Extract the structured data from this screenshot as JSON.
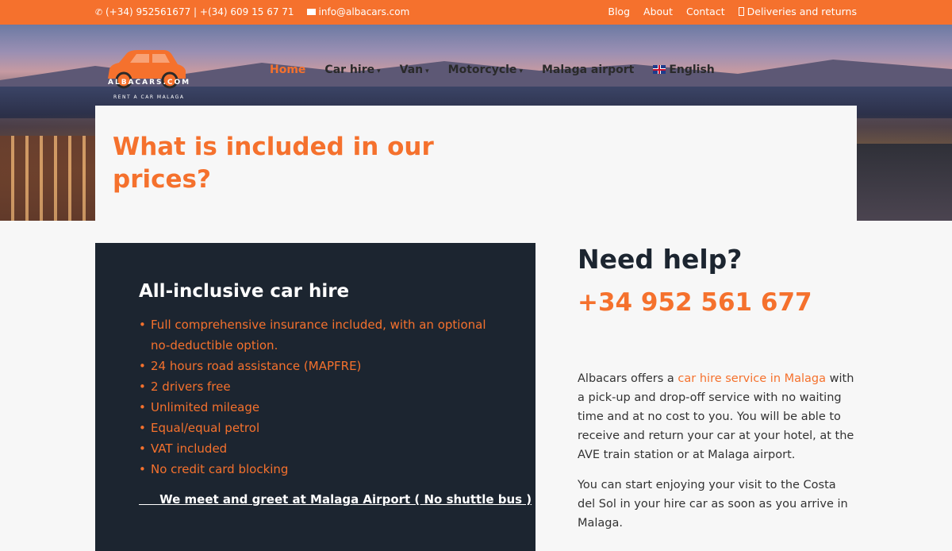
{
  "topbar": {
    "phones": "(+34) 952561677 | +(34) 609 15 67 71",
    "email": "info@albacars.com",
    "links": [
      "Blog",
      "About",
      "Contact",
      "Deliveries and returns"
    ]
  },
  "brand": {
    "logo_text": "ALBACARS.COM",
    "logo_sub": "RENT A CAR MALAGA"
  },
  "nav": {
    "items": [
      "Home",
      "Car hire",
      "Van",
      "Motorcycle",
      "Malaga airport",
      "English"
    ]
  },
  "hero": {
    "title": "What is included in our prices?"
  },
  "panel": {
    "heading": "All-inclusive car hire",
    "features": [
      "Full comprehensive insurance included, with an optional no-deductible option.",
      "24 hours road assistance (MAPFRE)",
      "2 drivers free",
      "Unlimited mileage",
      "Equal/equal petrol",
      "VAT included",
      "No credit card blocking"
    ],
    "meet": "     We meet and greet at Malaga Airport ( No shuttle bus )"
  },
  "help": {
    "heading": "Need help?",
    "phone": "+34 952 561 677",
    "p1_before": "Albacars offers a ",
    "p1_link": "car hire service in Malaga",
    "p1_after": " with a pick-up and drop-off service with no waiting time and at no cost to you. You will be able to receive and return your car at your hotel, at the AVE train station or at Malaga airport.",
    "p2": "You can start enjoying your visit to the Costa del Sol in your hire car as soon as you arrive in Malaga."
  },
  "colors": {
    "accent": "#f5712d",
    "dark_panel": "#1c2530",
    "page_bg": "#f7f7f7"
  }
}
